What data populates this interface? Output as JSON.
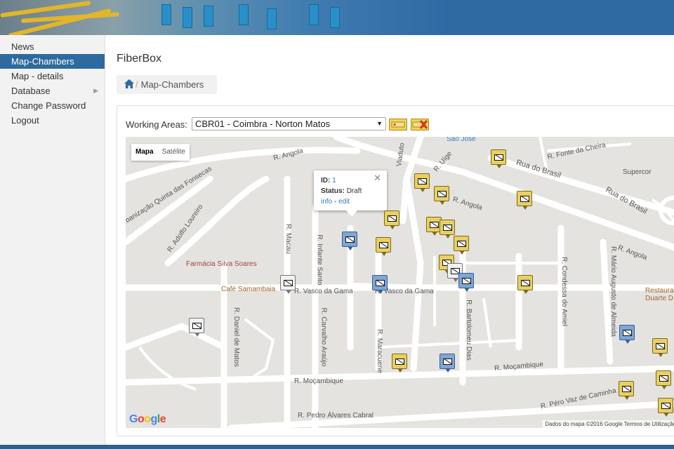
{
  "app": {
    "title": "FiberBox"
  },
  "sidebar": {
    "items": [
      {
        "label": "News",
        "active": false,
        "has_submenu": false
      },
      {
        "label": "Map-Chambers",
        "active": true,
        "has_submenu": false
      },
      {
        "label": "Map - details",
        "active": false,
        "has_submenu": false
      },
      {
        "label": "Database",
        "active": false,
        "has_submenu": true
      },
      {
        "label": "Change Password",
        "active": false,
        "has_submenu": false
      },
      {
        "label": "Logout",
        "active": false,
        "has_submenu": false
      }
    ]
  },
  "breadcrumb": {
    "icon": "home-icon",
    "current": "Map-Chambers"
  },
  "working_areas": {
    "label": "Working Areas:",
    "selected": "CBR01 - Coimbra - Norton Matos"
  },
  "map": {
    "type_control": {
      "map": "Mapa",
      "satellite": "Satélite"
    },
    "popup": {
      "id_label": "ID:",
      "id_value": "1",
      "status_label": "Status:",
      "status_value": "Draft",
      "info_link": "info",
      "separator": "-",
      "edit_link": "edit"
    },
    "attribution": "Dados do mapa ©2016 Google    Termos de Utilização",
    "logo_text": "Google",
    "streets": [
      "R. Angola",
      "Rua do Brasil",
      "Rua do Brasil",
      "R. Fonte da Cheira",
      "R. Vasco da Gama",
      "R. Vasco da Gama",
      "R. Moçambique",
      "R. Moçambique",
      "R. Pedro Álvares Cabral",
      "R. Péro Vaz de Caminha",
      "R. Macau",
      "R. Infante Santo",
      "R. Carvalho Araújo",
      "R. Daniel de Matos",
      "R. Adolfo Loureiro",
      "Urbanização Quinta das Fonsecas",
      "R. Bartolomeu Dias",
      "R. Condessa do Amiel",
      "R. Mário Augusto de Almeida",
      "R. Maracuene",
      "R. Angola",
      "R. Angola",
      "R. Uíge",
      "Viaduto"
    ],
    "pois": [
      "Farmácia Silva Soares",
      "Café Samambaia",
      "Supercor",
      "São José",
      "Restaura Duarte D"
    ],
    "colors": {
      "yellow": "#e8d062",
      "blue": "#7ea6d8",
      "white": "#f2f2f2"
    }
  }
}
